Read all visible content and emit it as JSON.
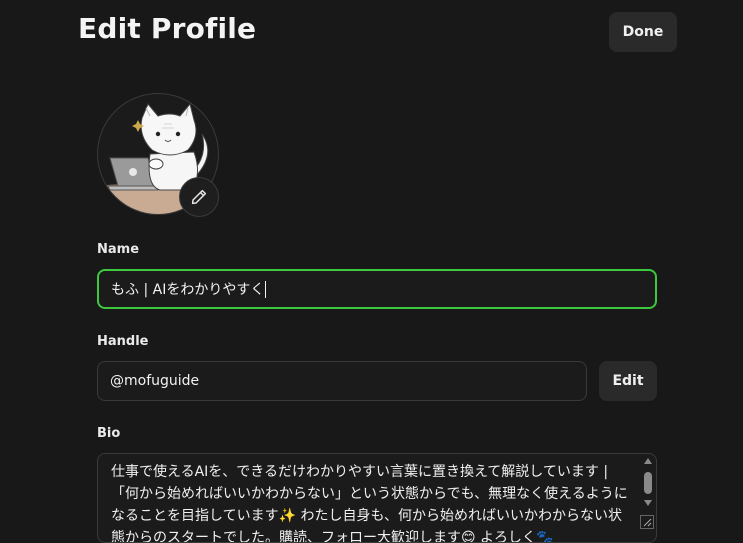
{
  "header": {
    "title": "Edit Profile",
    "done_label": "Done"
  },
  "avatar": {
    "edit_icon": "pencil-icon",
    "image": "cat-with-laptop-illustration"
  },
  "name": {
    "label": "Name",
    "value": "もふ | AIをわかりやすく"
  },
  "handle": {
    "label": "Handle",
    "value": "@mofuguide",
    "edit_label": "Edit"
  },
  "bio": {
    "label": "Bio",
    "value": "仕事で使えるAIを、できるだけわかりやすい言葉に置き換えて解説しています | 「何から始めればいいかわからない」という状態からでも、無理なく使えるようになることを目指しています✨ わたし自身も、何から始めればいいかわからない状態からのスタートでした。購読、フォロー大歓迎します😊 よろしく🐾"
  },
  "colors": {
    "background": "#181818",
    "focus_border": "#3ec83e",
    "button_bg": "#2a2a2a"
  }
}
